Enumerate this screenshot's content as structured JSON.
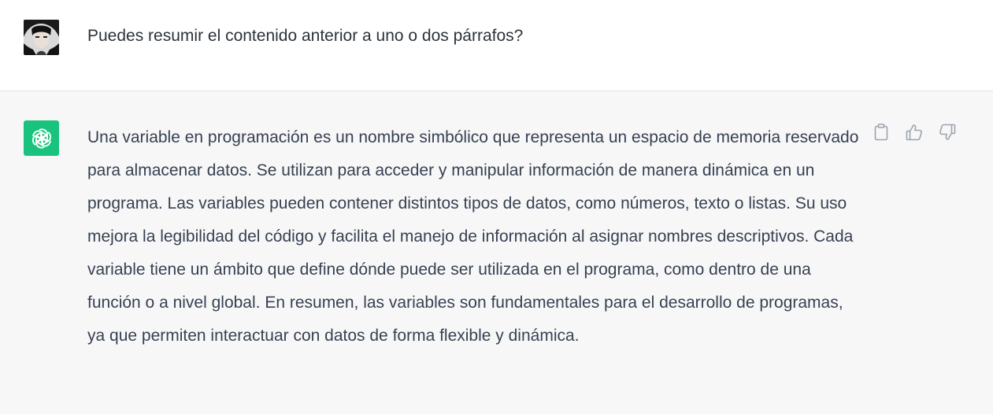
{
  "user_message": {
    "text": "Puedes resumir el contenido anterior a uno o dos párrafos?",
    "avatar": "user-avatar-photo"
  },
  "assistant_message": {
    "text": "Una variable en programación es un nombre simbólico que representa un espacio de memoria reservado para almacenar datos. Se utilizan para acceder y manipular información de manera dinámica en un programa. Las variables pueden contener distintos tipos de datos, como números, texto o listas. Su uso mejora la legibilidad del código y facilita el manejo de información al asignar nombres descriptivos. Cada variable tiene un ámbito que define dónde puede ser utilizada en el programa, como dentro de una función o a nivel global. En resumen, las variables son fundamentales para el desarrollo de programas, ya que permiten interactuar con datos de forma flexible y dinámica.",
    "avatar": "openai-logo-icon",
    "avatar_color": "#19c37d"
  },
  "actions": [
    {
      "icon": "clipboard-icon"
    },
    {
      "icon": "thumbs-up-icon"
    },
    {
      "icon": "thumbs-down-icon"
    }
  ],
  "colors": {
    "user_bg": "#ffffff",
    "assistant_bg": "#f7f7f8",
    "text": "#374151",
    "icon": "#9ca3af"
  }
}
